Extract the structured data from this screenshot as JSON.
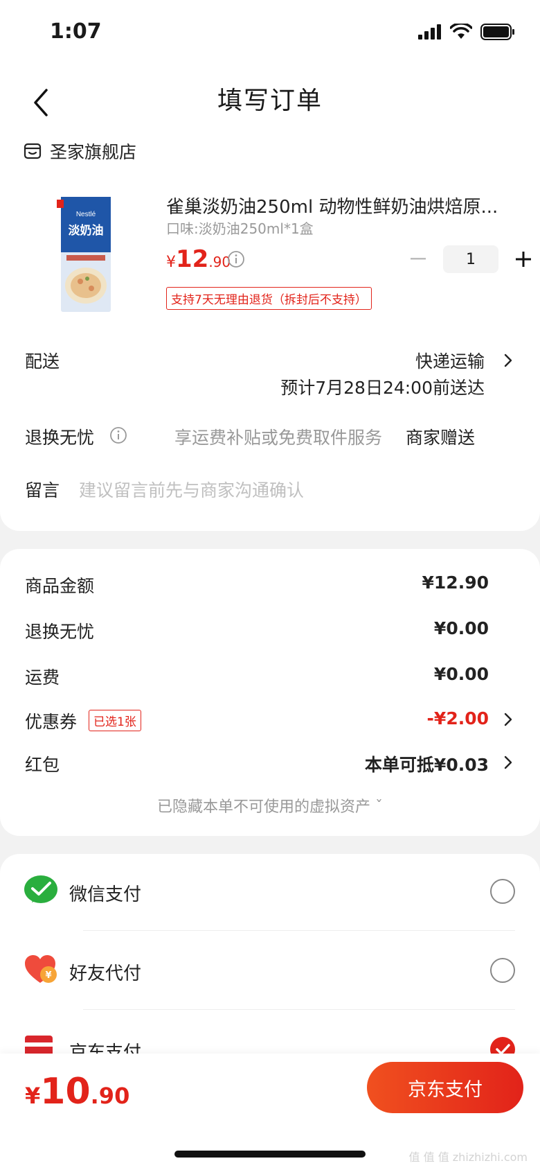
{
  "status_bar": {
    "time": "1:07"
  },
  "nav": {
    "title": "填写订单"
  },
  "shop": {
    "name": "圣家旗舰店"
  },
  "product": {
    "title": "雀巢淡奶油250ml 动物性鲜奶油烘焙原...",
    "spec": "口味:淡奶油250ml*1盒",
    "price_symbol": "¥",
    "price_int": "12",
    "price_dec": ".90",
    "quantity": "1",
    "return_policy": "支持7天无理由退货（拆封后不支持）",
    "image_label": "淡奶油",
    "image_brand": "雀巢 Nestlé"
  },
  "delivery": {
    "label": "配送",
    "method": "快递运输",
    "eta": "预计7月28日24:00前送达"
  },
  "worry_free": {
    "label": "退换无忧",
    "description": "享运费补贴或免费取件服务",
    "gift": "商家赠送"
  },
  "message": {
    "label": "留言",
    "placeholder": "建议留言前先与商家沟通确认"
  },
  "amounts": [
    {
      "label": "商品金额",
      "value": "¥12.90"
    },
    {
      "label": "退换无忧",
      "value": "¥0.00"
    },
    {
      "label": "运费",
      "value": "¥0.00"
    },
    {
      "label": "优惠券",
      "badge": "已选1张",
      "value": "-¥2.00"
    },
    {
      "label": "红包",
      "value": "本单可抵¥0.03"
    }
  ],
  "hidden_assets": "已隐藏本单不可使用的虚拟资产 ˇ",
  "payments": [
    {
      "label": "微信支付",
      "icon": "wechat-pay-icon",
      "selected": false
    },
    {
      "label": "好友代付",
      "icon": "friend-pay-icon",
      "selected": false
    },
    {
      "label": "京东支付",
      "icon": "jd-pay-icon",
      "selected": true
    }
  ],
  "bottom": {
    "total_symbol": "¥",
    "total_int": "10",
    "total_dec": ".90",
    "pay_button": "京东支付"
  },
  "watermark": "值 值 值 zhizhizhi.com",
  "colors": {
    "accent": "#e2231a",
    "wechat": "#2aae3e"
  }
}
